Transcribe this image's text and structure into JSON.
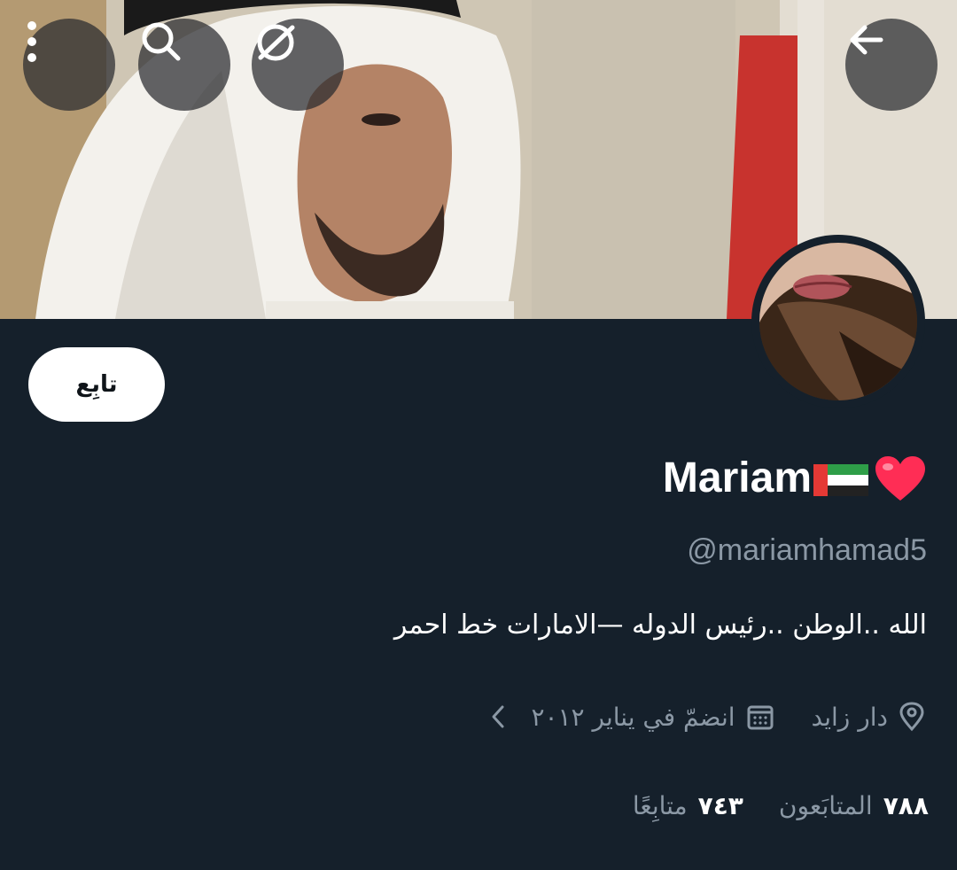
{
  "profile": {
    "name": "Mariam",
    "name_emoji": "🇦🇪❤️",
    "handle": "@mariamhamad5",
    "bio": "الله ..الوطن ..رئيس الدوله —الامارات خط احمر",
    "location": "دار زايد",
    "joined": "انضمّ في يناير ٢٠١٢",
    "followers_count": "٧٨٨",
    "followers_label": "المتابَعون",
    "following_count": "٧٤٣",
    "following_label": "متابِعًا"
  },
  "actions": {
    "follow_label": "تابِع"
  },
  "icons": {
    "back": "arrow-left-icon",
    "grok": "grok-icon",
    "search": "search-icon",
    "more": "more-vertical-icon",
    "location": "location-pin-icon",
    "calendar": "calendar-icon",
    "chevron": "chevron-left-icon"
  },
  "colors": {
    "background": "#15202b",
    "secondary_text": "#8b98a5",
    "primary_text": "#ffffff",
    "button_bg": "#ffffff"
  }
}
